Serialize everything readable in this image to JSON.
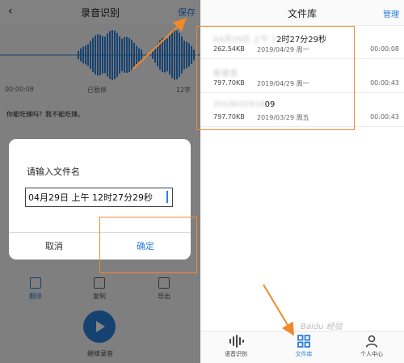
{
  "left_panel": {
    "back_icon": "chevron-left-icon",
    "title": "录音识别",
    "save_label": "保存",
    "timeline": {
      "elapsed": "00:00:08",
      "status": "已暂停",
      "chars": "12字"
    },
    "recognized_text": "你能吃辣吗？我不能吃辣。",
    "tools": [
      {
        "label": "翻译",
        "icon": "translate-icon"
      },
      {
        "label": "复制",
        "icon": "copy-icon"
      },
      {
        "label": "导出",
        "icon": "export-icon"
      }
    ],
    "record_button_label": "继续录音"
  },
  "dialog": {
    "title": "请输入文件名",
    "input_value": "04月29日 上午 12时27分29秒",
    "cancel_label": "取消",
    "confirm_label": "确定"
  },
  "right_panel": {
    "title": "文件库",
    "manage_label": "管理",
    "files": [
      {
        "name_blurred": "04月29日 上午 1",
        "name_visible": "2时27分29秒",
        "size": "262.54KB",
        "date": "2019/04/29 周一",
        "duration": "00:00:08"
      },
      {
        "name_blurred": "新录音",
        "name_visible": "",
        "size": "797.70KB",
        "date": "2019/04/29 周一",
        "duration": "00:00:43"
      },
      {
        "name_blurred": "2019032918",
        "name_visible": "09",
        "size": "797.70KB",
        "date": "2019/03/29 周五",
        "duration": "00:00:43"
      }
    ],
    "tabs": [
      {
        "label": "语音识别",
        "icon": "waveform-icon"
      },
      {
        "label": "文件库",
        "icon": "grid-icon"
      },
      {
        "label": "个人中心",
        "icon": "person-icon"
      }
    ]
  },
  "watermark": "Baidu 经验",
  "colors": {
    "accent": "#2b7fd9",
    "highlight": "#f08a2a"
  }
}
